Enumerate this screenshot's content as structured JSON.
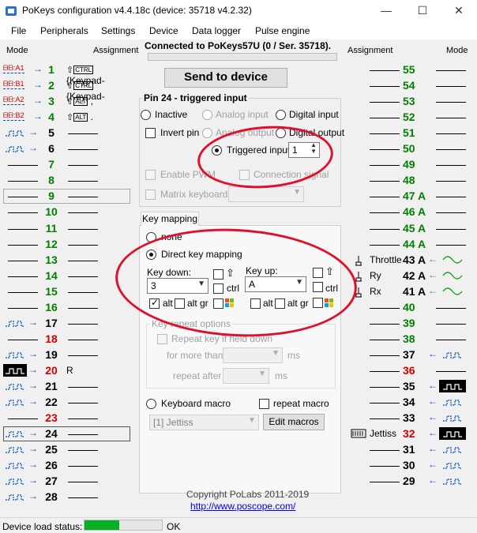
{
  "window": {
    "title": "PoKeys configuration v4.4.18c (device: 35718 v4.2.32)",
    "min": "—",
    "max": "☐",
    "close": "✕"
  },
  "menu": [
    "File",
    "Peripherals",
    "Settings",
    "Device",
    "Data logger",
    "Pulse engine"
  ],
  "headers": {
    "mode_left": "Mode",
    "assignment_left": "Assignment",
    "assignment_right": "Assignment",
    "mode_right": "Mode"
  },
  "connection": "Connected to PoKeys57U (0 / Ser. 35718).",
  "send_button": "Send to device",
  "pin_panel": {
    "title": "Pin 24 - triggered input",
    "inactive": "Inactive",
    "analog_input": "Analog input",
    "digital_input": "Digital input",
    "invert_pin": "Invert pin",
    "analog_output": "Analog output",
    "digital_output": "Digital output",
    "triggered_input": "Triggered input",
    "triggered_value": "1",
    "enable_pwm": "Enable PWM",
    "connection_signal": "Connection signal",
    "matrix_keyboard": "Matrix keyboard"
  },
  "key_mapping": {
    "tab": "Key mapping",
    "none": "none",
    "direct": "Direct key mapping",
    "key_down": "Key down:",
    "key_down_value": "3",
    "key_up": "Key up:",
    "key_up_value": "A",
    "ctrl": "ctrl",
    "alt": "alt",
    "alt_gr": "alt gr",
    "repeat_options": "Key repeat options",
    "repeat_if_held": "Repeat key if held down",
    "for_more_than": "for more than",
    "repeat_after": "repeat after",
    "ms": "ms",
    "keyboard_macro": "Keyboard macro",
    "repeat_macro": "repeat macro",
    "macro_value": "[1] Jettiss",
    "edit_macros": "Edit macros"
  },
  "copyright": "Copyright PoLabs 2011-2019",
  "url": "http://www.poscope.com/",
  "status": {
    "label": "Device load status:",
    "progress": 0.45,
    "text": "OK"
  },
  "left_pins": [
    {
      "num": "1",
      "color": "green",
      "mode": "A1",
      "assign": "{Keypad-"
    },
    {
      "num": "2",
      "color": "green",
      "mode": "B1",
      "assign": "{Keypad-"
    },
    {
      "num": "3",
      "color": "green",
      "mode": "A2",
      "assign": ","
    },
    {
      "num": "4",
      "color": "green",
      "mode": "B2",
      "assign": "."
    },
    {
      "num": "5",
      "color": "black",
      "mode": "in",
      "assign": ""
    },
    {
      "num": "6",
      "color": "black",
      "mode": "in",
      "assign": ""
    },
    {
      "num": "7",
      "color": "green",
      "mode": "",
      "assign": ""
    },
    {
      "num": "8",
      "color": "green",
      "mode": "",
      "assign": ""
    },
    {
      "num": "9",
      "color": "green",
      "mode": "",
      "assign": ""
    },
    {
      "num": "10",
      "color": "green",
      "mode": "",
      "assign": ""
    },
    {
      "num": "11",
      "color": "green",
      "mode": "",
      "assign": ""
    },
    {
      "num": "12",
      "color": "green",
      "mode": "",
      "assign": ""
    },
    {
      "num": "13",
      "color": "green",
      "mode": "",
      "assign": ""
    },
    {
      "num": "14",
      "color": "green",
      "mode": "",
      "assign": ""
    },
    {
      "num": "15",
      "color": "green",
      "mode": "",
      "assign": ""
    },
    {
      "num": "16",
      "color": "green",
      "mode": "",
      "assign": ""
    },
    {
      "num": "17",
      "color": "black",
      "mode": "in",
      "assign": ""
    },
    {
      "num": "18",
      "color": "red",
      "mode": "",
      "assign": ""
    },
    {
      "num": "19",
      "color": "black",
      "mode": "in",
      "assign": ""
    },
    {
      "num": "20",
      "color": "red",
      "mode": "inv",
      "assign": "R"
    },
    {
      "num": "21",
      "color": "black",
      "mode": "in",
      "assign": ""
    },
    {
      "num": "22",
      "color": "black",
      "mode": "in",
      "assign": ""
    },
    {
      "num": "23",
      "color": "red",
      "mode": "",
      "assign": ""
    },
    {
      "num": "24",
      "color": "black",
      "mode": "in",
      "assign": ""
    },
    {
      "num": "25",
      "color": "black",
      "mode": "in",
      "assign": ""
    },
    {
      "num": "26",
      "color": "black",
      "mode": "in",
      "assign": ""
    },
    {
      "num": "27",
      "color": "black",
      "mode": "in",
      "assign": ""
    },
    {
      "num": "28",
      "color": "black",
      "mode": "in",
      "assign": ""
    }
  ],
  "right_pins": [
    {
      "num": "55",
      "color": "green",
      "assign": "",
      "mode": ""
    },
    {
      "num": "54",
      "color": "green",
      "assign": "",
      "mode": ""
    },
    {
      "num": "53",
      "color": "green",
      "assign": "",
      "mode": ""
    },
    {
      "num": "52",
      "color": "green",
      "assign": "",
      "mode": ""
    },
    {
      "num": "51",
      "color": "green",
      "assign": "",
      "mode": ""
    },
    {
      "num": "50",
      "color": "green",
      "assign": "",
      "mode": ""
    },
    {
      "num": "49",
      "color": "green",
      "assign": "",
      "mode": ""
    },
    {
      "num": "48",
      "color": "green",
      "assign": "",
      "mode": ""
    },
    {
      "num": "47 A",
      "color": "green",
      "assign": "",
      "mode": ""
    },
    {
      "num": "46 A",
      "color": "green",
      "assign": "",
      "mode": ""
    },
    {
      "num": "45 A",
      "color": "green",
      "assign": "",
      "mode": ""
    },
    {
      "num": "44 A",
      "color": "green",
      "assign": "",
      "mode": ""
    },
    {
      "num": "43 A",
      "color": "black",
      "assign": "Throttle",
      "mode": "analog"
    },
    {
      "num": "42 A",
      "color": "black",
      "assign": "Ry",
      "mode": "analog"
    },
    {
      "num": "41 A",
      "color": "black",
      "assign": "Rx",
      "mode": "analog"
    },
    {
      "num": "40",
      "color": "green",
      "assign": "",
      "mode": ""
    },
    {
      "num": "39",
      "color": "green",
      "assign": "",
      "mode": ""
    },
    {
      "num": "38",
      "color": "green",
      "assign": "",
      "mode": ""
    },
    {
      "num": "37",
      "color": "black",
      "assign": "",
      "mode": "in"
    },
    {
      "num": "36",
      "color": "red",
      "assign": "",
      "mode": ""
    },
    {
      "num": "35",
      "color": "black",
      "assign": "",
      "mode": "inv"
    },
    {
      "num": "34",
      "color": "black",
      "assign": "",
      "mode": "in"
    },
    {
      "num": "33",
      "color": "black",
      "assign": "",
      "mode": "in"
    },
    {
      "num": "32",
      "color": "red",
      "assign": "Jettiss",
      "mode": "inv"
    },
    {
      "num": "31",
      "color": "black",
      "assign": "",
      "mode": "in"
    },
    {
      "num": "30",
      "color": "black",
      "assign": "",
      "mode": "in"
    },
    {
      "num": "29",
      "color": "black",
      "assign": "",
      "mode": "in"
    }
  ]
}
